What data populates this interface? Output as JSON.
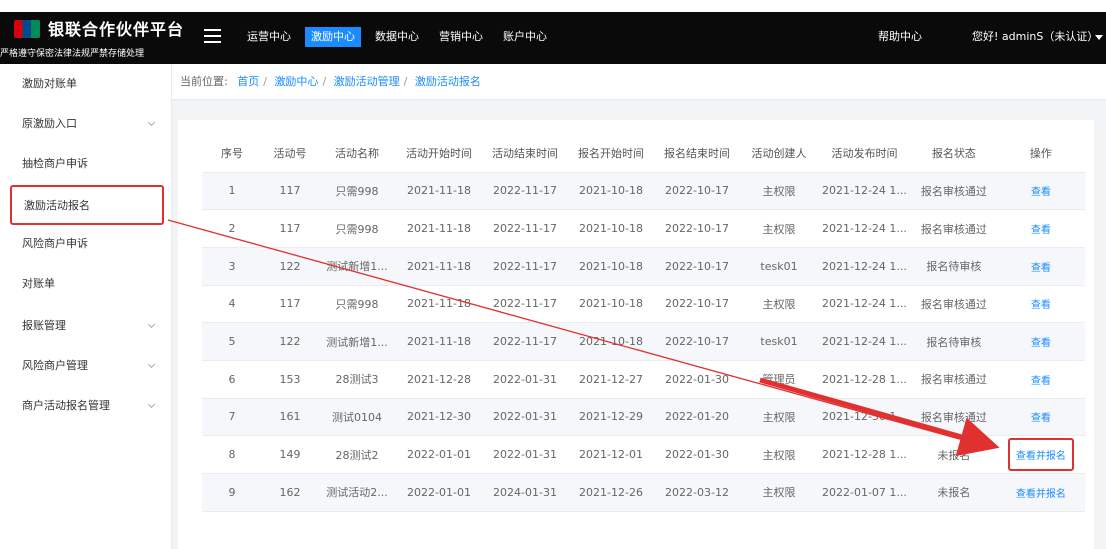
{
  "header": {
    "brand": "银联合作伙伴平台",
    "slogan": "严格遵守保密法律法规严禁存储处理",
    "nav": [
      "运营中心",
      "激励中心",
      "数据中心",
      "营销中心",
      "账户中心"
    ],
    "active_nav": "激励中心",
    "help": "帮助中心",
    "user": "您好! adminS（未认证）"
  },
  "sidebar": {
    "items": [
      {
        "label": "激励对账单"
      },
      {
        "label": "原激励入口"
      },
      {
        "label": "抽检商户申诉"
      },
      {
        "label": "激励活动报名"
      },
      {
        "label": "风险商户申诉"
      },
      {
        "label": "对账单"
      },
      {
        "label": "报账管理"
      },
      {
        "label": "风险商户管理"
      },
      {
        "label": "商户活动报名管理"
      }
    ]
  },
  "breadcrumb": {
    "prefix": "当前位置:",
    "items": [
      "首页",
      "激励中心",
      "激励活动管理",
      "激励活动报名"
    ]
  },
  "table": {
    "columns": [
      "序号",
      "活动号",
      "活动名称",
      "活动开始时间",
      "活动结束时间",
      "报名开始时间",
      "报名结束时间",
      "活动创建人",
      "活动发布时间",
      "报名状态",
      "操作"
    ],
    "rows": [
      [
        "1",
        "117",
        "只需998",
        "2021-11-18",
        "2022-11-17",
        "2021-10-18",
        "2022-10-17",
        "主权限",
        "2021-12-24 1...",
        "报名审核通过",
        "查看"
      ],
      [
        "2",
        "117",
        "只需998",
        "2021-11-18",
        "2022-11-17",
        "2021-10-18",
        "2022-10-17",
        "主权限",
        "2021-12-24 1...",
        "报名审核通过",
        "查看"
      ],
      [
        "3",
        "122",
        "测试新增1...",
        "2021-11-18",
        "2022-11-17",
        "2021-10-18",
        "2022-10-17",
        "tesk01",
        "2021-12-24 1...",
        "报名待审核",
        "查看"
      ],
      [
        "4",
        "117",
        "只需998",
        "2021-11-18",
        "2022-11-17",
        "2021-10-18",
        "2022-10-17",
        "主权限",
        "2021-12-24 1...",
        "报名审核通过",
        "查看"
      ],
      [
        "5",
        "122",
        "测试新增1...",
        "2021-11-18",
        "2022-11-17",
        "2021-10-18",
        "2022-10-17",
        "tesk01",
        "2021-12-24 1...",
        "报名待审核",
        "查看"
      ],
      [
        "6",
        "153",
        "28测试3",
        "2021-12-28",
        "2022-01-31",
        "2021-12-27",
        "2022-01-30",
        "管理员",
        "2021-12-28 1...",
        "报名审核通过",
        "查看"
      ],
      [
        "7",
        "161",
        "测试0104",
        "2021-12-30",
        "2022-01-31",
        "2021-12-29",
        "2022-01-20",
        "主权限",
        "2021-12-30 1...",
        "报名审核通过",
        "查看"
      ],
      [
        "8",
        "149",
        "28测试2",
        "2022-01-01",
        "2022-01-31",
        "2021-12-01",
        "2022-01-30",
        "主权限",
        "2021-12-28 1...",
        "未报名",
        "查看并报名"
      ],
      [
        "9",
        "162",
        "测试活动2...",
        "2022-01-01",
        "2024-01-31",
        "2021-12-26",
        "2022-03-12",
        "主权限",
        "2022-01-07 1...",
        "未报名",
        "查看并报名"
      ]
    ]
  },
  "annotation": {
    "color": "#e03030"
  }
}
